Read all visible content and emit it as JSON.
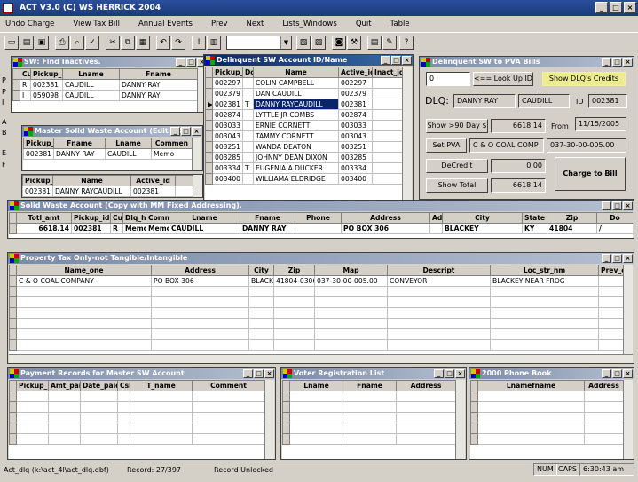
{
  "app": {
    "title": "ACT V3.0 (C) WS HERRICK 2004"
  },
  "menu": [
    "Undo Charge",
    "View Tax Bill",
    "Annual Events",
    "Prev",
    "Next",
    "Lists_Windows",
    "Quit",
    "Table"
  ],
  "sw_find": {
    "title": "SW: Find Inactives.",
    "headers": [
      "Cu",
      "Pickup_",
      "Lname",
      "Fname"
    ],
    "rows": [
      [
        "R",
        "002381",
        "CAUDILL",
        "DANNY RAY"
      ],
      [
        "I",
        "059098",
        "CAUDILL",
        "DANNY RAY"
      ]
    ]
  },
  "master_sw": {
    "title": "Master Solid Waste Account (Edit OK).",
    "headers": [
      "Pickup_",
      "Fname",
      "Lname",
      "Commen"
    ],
    "rows": [
      [
        "002381",
        "DANNY RAY",
        "CAUDILL",
        "Memo"
      ]
    ]
  },
  "small_grid": {
    "headers": [
      "Pickup_",
      "Name",
      "Active_id"
    ],
    "rows": [
      [
        "002381",
        "DANNY RAYCAUDILL",
        "002381"
      ]
    ]
  },
  "delinquent": {
    "title": "Delinquent SW Account ID/Name",
    "headers": [
      "Pickup_",
      "Do",
      "Name",
      "Active_id",
      "Inact_id"
    ],
    "rows": [
      [
        "002297",
        "",
        "COLIN CAMPBELL",
        "002297",
        ""
      ],
      [
        "002379",
        "",
        "DAN CAUDILL",
        "002379",
        ""
      ],
      [
        "002381",
        "T",
        "DANNY RAYCAUDILL",
        "002381",
        ""
      ],
      [
        "002874",
        "",
        "LYTTLE JR COMBS",
        "002874",
        ""
      ],
      [
        "003033",
        "",
        "ERNIE CORNETT",
        "003033",
        ""
      ],
      [
        "003043",
        "",
        "TAMMY CORNETT",
        "003043",
        ""
      ],
      [
        "003251",
        "",
        "WANDA DEATON",
        "003251",
        ""
      ],
      [
        "003285",
        "",
        "JOHNNY DEAN DIXON",
        "003285",
        ""
      ],
      [
        "003334",
        "T",
        "EUGENIA A DUCKER",
        "003334",
        ""
      ],
      [
        "003400",
        "",
        "WILLIAMA ELDRIDGE",
        "003400",
        ""
      ]
    ]
  },
  "pva": {
    "title": "Delinquent SW to PVA Bills",
    "lookup_value": "0",
    "lookup_label": "<== Look Up ID",
    "show_credits": "Show DLQ's Credits",
    "dlq_label": "DLQ:",
    "dlq_fname": "DANNY RAY",
    "dlq_lname": "CAUDILL",
    "id_label": "ID",
    "id_value": "002381",
    "show90": "Show >90 Day $",
    "amt90": "6618.14",
    "from_label": "From",
    "from_date": "11/15/2005",
    "set_pva": "Set PVA",
    "pva_name": "C & O COAL COMP",
    "pva_map": "037-30-00-005.00",
    "decredit": "DeCredit",
    "decredit_amt": "0.00",
    "charge": "Charge to Bill",
    "show_total": "Show Total",
    "total": "6618.14"
  },
  "sw_account": {
    "title": "Solid Waste  Account (Copy with MM Fixed Addressing).",
    "headers": [
      "Totl_amt",
      "Pickup_id",
      "Cu",
      "Dlq_his",
      "Comm",
      "Lname",
      "Fname",
      "Phone",
      "Address",
      "Ad",
      "City",
      "State",
      "Zip",
      "Do"
    ],
    "rows": [
      [
        "6618.14",
        "002381",
        "R",
        "Memo",
        "Memo",
        "CAUDILL",
        "DANNY RAY",
        "",
        "PO BOX 306",
        "",
        "BLACKEY",
        "KY",
        "41804",
        "/"
      ]
    ]
  },
  "property": {
    "title": "Property Tax Only-not Tangible/Intangible",
    "headers": [
      "Name_one",
      "Address",
      "City",
      "Zip",
      "Map",
      "Descript",
      "Loc_str_nm",
      "Prev_own"
    ],
    "rows": [
      [
        "C & O COAL COMPANY",
        "PO BOX 306",
        "BLACKEY",
        "41804-0306",
        "037-30-00-005.00",
        "CONVEYOR",
        "BLACKEY NEAR FROG",
        ""
      ]
    ]
  },
  "payment": {
    "title": "Payment Records for Master SW Account",
    "headers": [
      "Pickup_i",
      "Amt_paid",
      "Date_paid",
      "Csl",
      "T_name",
      "Comment"
    ]
  },
  "voter": {
    "title": "Voter Registration List",
    "headers": [
      "Lname",
      "Fname",
      "Address"
    ]
  },
  "phone": {
    "title": "2000 Phone Book",
    "headers": [
      "Lnamefname",
      "Address"
    ]
  },
  "status": {
    "file": "Act_dlq (k:\\act_4l\\act_dlq.dbf)",
    "record": "Record: 27/397",
    "lock": "Record Unlocked",
    "num": "NUM",
    "caps": "CAPS",
    "time": "6:30:43 am"
  },
  "side_letters": [
    "P",
    "P",
    "I",
    "A",
    "B",
    "E",
    "F"
  ]
}
